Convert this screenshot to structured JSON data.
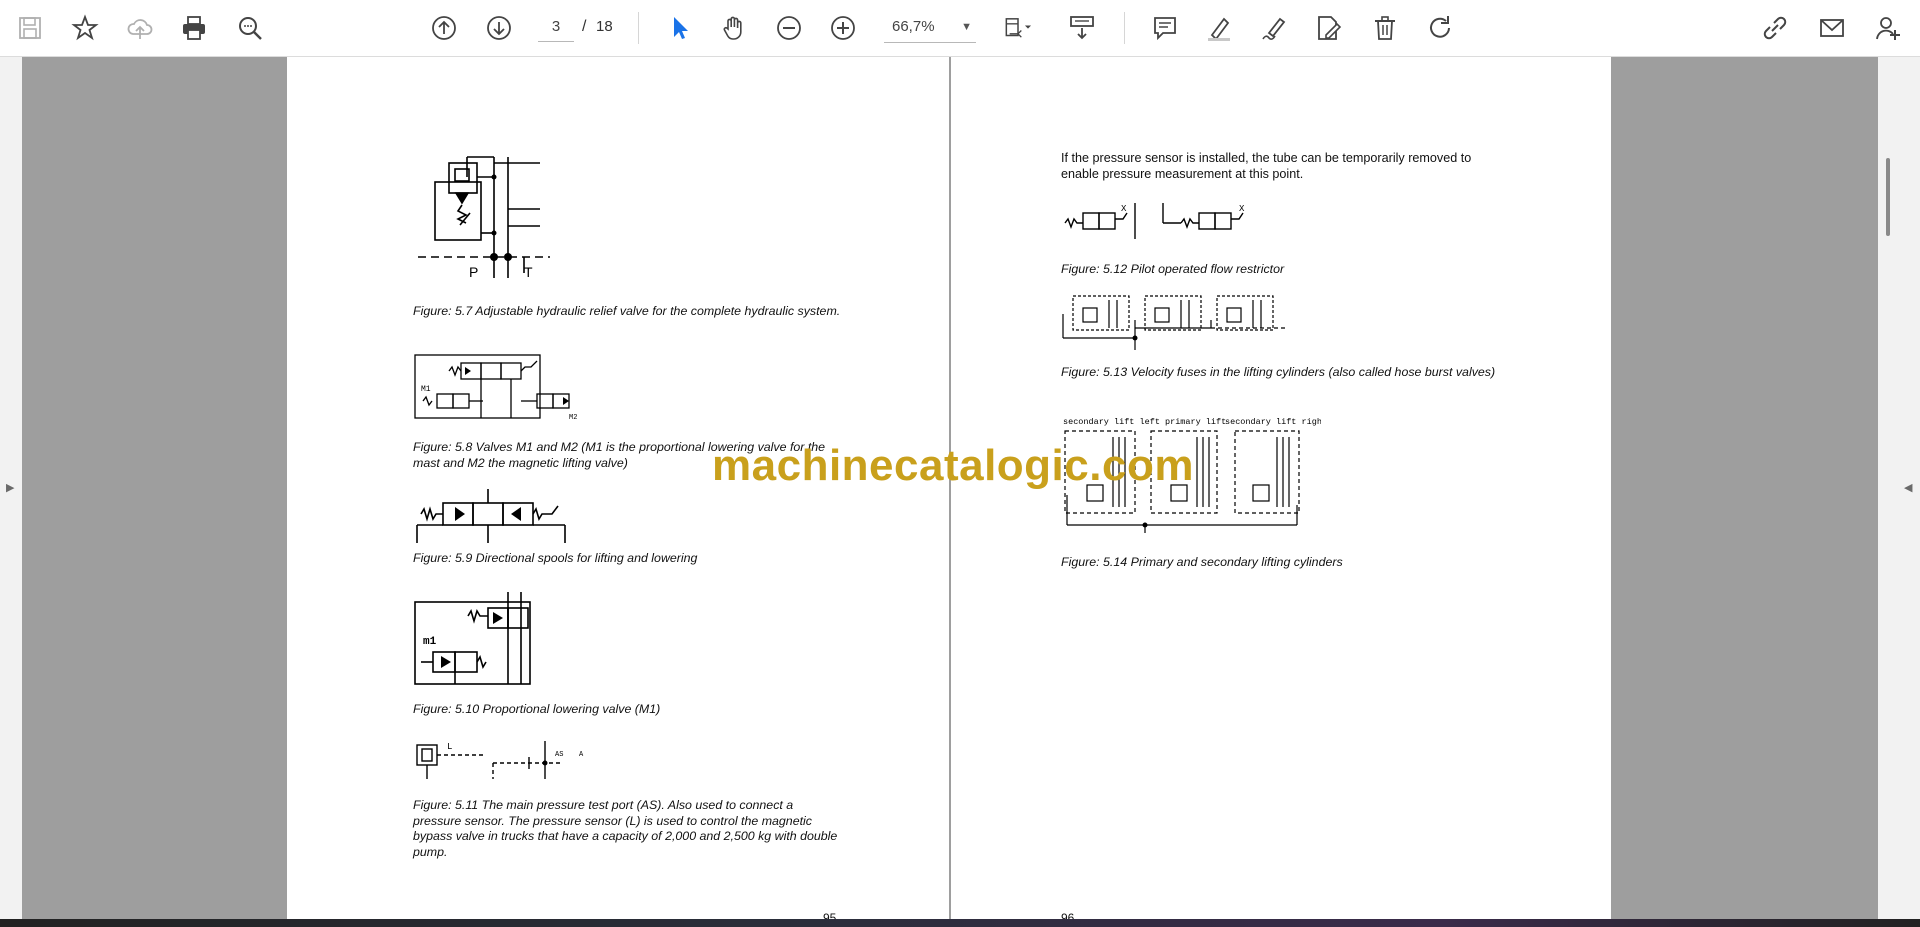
{
  "toolbar": {
    "icons": [
      "save-icon",
      "bookmark-star-icon",
      "cloud-upload-icon",
      "print-icon",
      "zoom-search-icon",
      "page-up-icon",
      "page-down-icon",
      "select-cursor-icon",
      "hand-tool-icon",
      "zoom-out-icon",
      "zoom-in-icon",
      "fit-page-icon",
      "scroll-mode-icon",
      "comment-icon",
      "highlight-pen-icon",
      "sign-icon",
      "edit-pdf-icon",
      "delete-icon",
      "rotate-icon",
      "share-link-icon",
      "mail-icon",
      "add-user-icon"
    ],
    "current_page": "3",
    "page_separator": "/",
    "total_pages": "18",
    "zoom_value": "66,7%",
    "accent": "#1a73e8"
  },
  "page_left": {
    "captions": [
      "Figure: 5.7 Adjustable hydraulic relief valve for the complete hydraulic system.",
      "Figure: 5.8 Valves M1 and M2 (M1 is the proportional lowering valve for the mast and M2 the magnetic lifting valve)",
      "Figure: 5.9 Directional spools for lifting and lowering",
      "Figure: 5.10 Proportional lowering valve (M1)",
      "Figure: 5.11 The main pressure test port (AS). Also used to connect a pressure sensor. The pressure sensor (L) is used to control the magnetic bypass valve in trucks that have a capacity of 2,000 and 2,500 kg with double pump."
    ],
    "fig_labels": {
      "p": "P",
      "t": "T",
      "m1": "M1",
      "m2": "M2",
      "m1_large": "m1",
      "l": "L",
      "as": "AS",
      "a": "A"
    },
    "page_number": "95"
  },
  "page_right": {
    "intro": "If the pressure sensor is installed, the tube can be temporarily removed to enable pressure measurement at this point.",
    "captions": [
      "Figure: 5.12 Pilot operated flow restrictor",
      "Figure: 5.13 Velocity fuses in the lifting cylinders (also called hose burst valves)",
      "Figure: 5.14 Primary and secondary lifting cylinders"
    ],
    "fig_labels": {
      "x1": "X",
      "x2": "X",
      "secondary_left": "secondary lift left",
      "primary": "primary lift",
      "secondary_right": "secondary lift right"
    },
    "page_number": "96"
  },
  "watermark": "machinecatalogic.com"
}
